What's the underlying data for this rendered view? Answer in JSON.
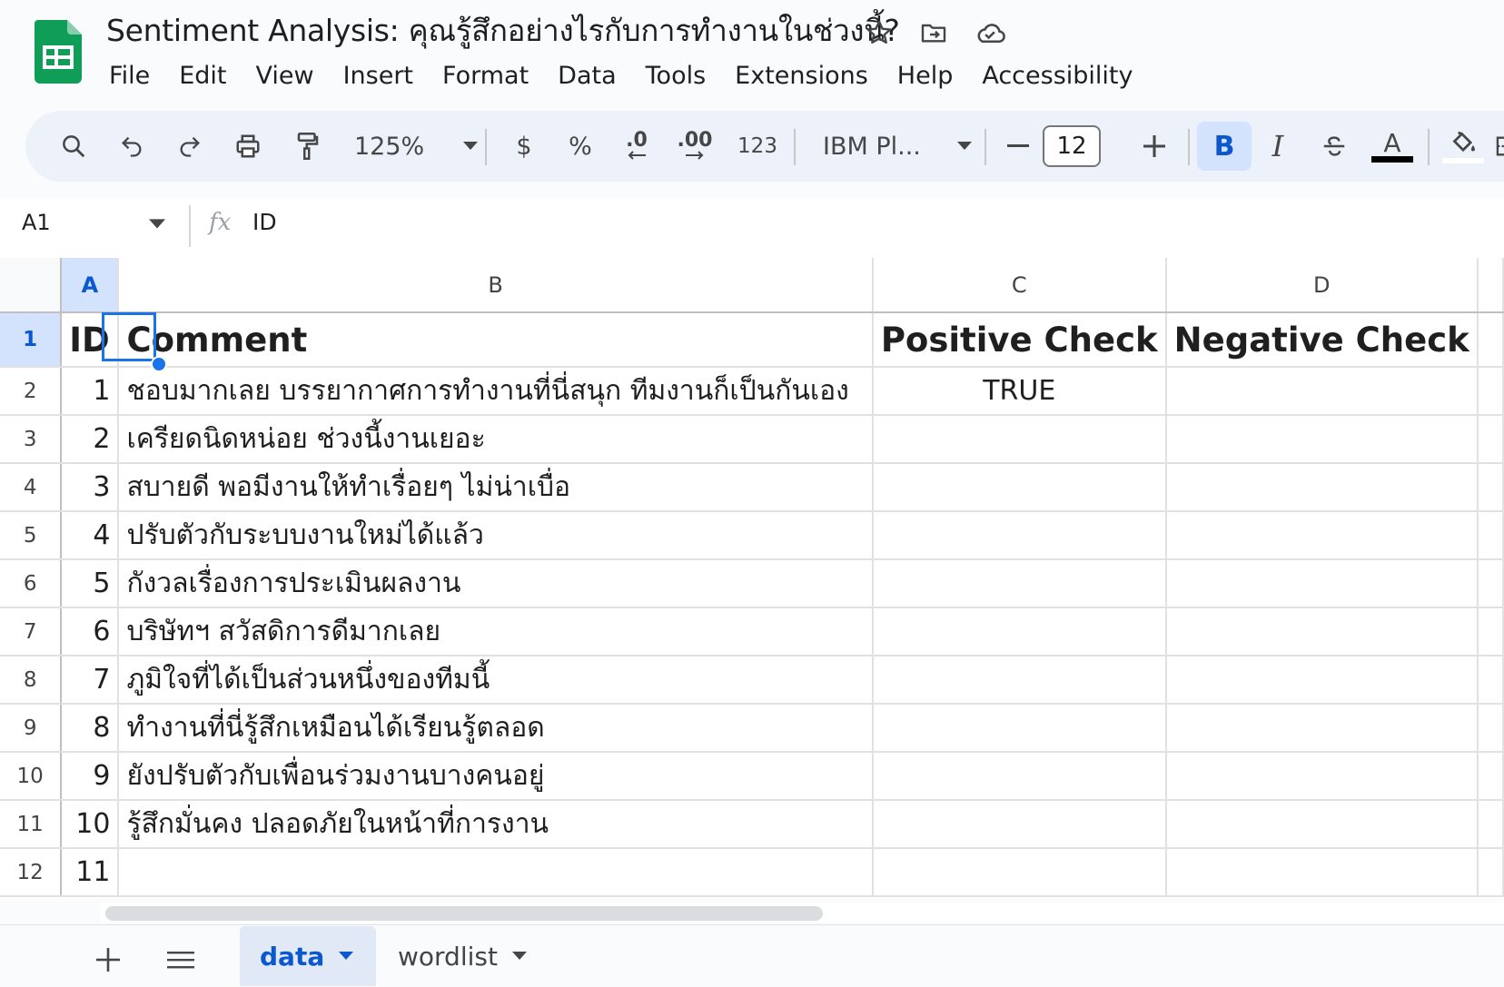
{
  "title": "Sentiment Analysis: คุณรู้สึกอย่างไรกับการทำงานในช่วงนี้?",
  "menu": [
    "File",
    "Edit",
    "View",
    "Insert",
    "Format",
    "Data",
    "Tools",
    "Extensions",
    "Help",
    "Accessibility"
  ],
  "toolbar": {
    "zoom": "125%",
    "currency": "$",
    "percent": "%",
    "decrease_decimal": ".0",
    "increase_decimal": ".00",
    "number_format": "123",
    "font": "IBM Pl...",
    "font_size": "12",
    "bold": "B",
    "italic": "I",
    "text_color": "A"
  },
  "formula_bar": {
    "name_box": "A1",
    "fx": "fx",
    "value": "ID"
  },
  "columns": [
    "A",
    "B",
    "C",
    "D"
  ],
  "rows": [
    {
      "num": "1",
      "a": "ID",
      "b": "Comment",
      "c": "Positive Check",
      "d": "Negative Check"
    },
    {
      "num": "2",
      "a": "1",
      "b": "ชอบมากเลย บรรยากาศการทำงานที่นี่สนุก ทีมงานก็เป็นกันเอง",
      "c": "TRUE",
      "d": ""
    },
    {
      "num": "3",
      "a": "2",
      "b": "เครียดนิดหน่อย ช่วงนี้งานเยอะ",
      "c": "",
      "d": ""
    },
    {
      "num": "4",
      "a": "3",
      "b": "สบายดี พอมีงานให้ทำเรื่อยๆ ไม่น่าเบื่อ",
      "c": "",
      "d": ""
    },
    {
      "num": "5",
      "a": "4",
      "b": "ปรับตัวกับระบบงานใหม่ได้แล้ว",
      "c": "",
      "d": ""
    },
    {
      "num": "6",
      "a": "5",
      "b": "กังวลเรื่องการประเมินผลงาน",
      "c": "",
      "d": ""
    },
    {
      "num": "7",
      "a": "6",
      "b": "บริษัทฯ สวัสดิการดีมากเลย",
      "c": "",
      "d": ""
    },
    {
      "num": "8",
      "a": "7",
      "b": "ภูมิใจที่ได้เป็นส่วนหนึ่งของทีมนี้",
      "c": "",
      "d": ""
    },
    {
      "num": "9",
      "a": "8",
      "b": "ทำงานที่นี่รู้สึกเหมือนได้เรียนรู้ตลอด",
      "c": "",
      "d": ""
    },
    {
      "num": "10",
      "a": "9",
      "b": "ยังปรับตัวกับเพื่อนร่วมงานบางคนอยู่",
      "c": "",
      "d": ""
    },
    {
      "num": "11",
      "a": "10",
      "b": "รู้สึกมั่นคง ปลอดภัยในหน้าที่การงาน",
      "c": "",
      "d": ""
    },
    {
      "num": "12",
      "a": "11",
      "b": "",
      "c": "",
      "d": ""
    }
  ],
  "sheet_tabs": [
    "data",
    "wordlist"
  ],
  "colors": {
    "accent": "#0b57d0",
    "selection": "#1a73e8",
    "toolbar_bg": "#edf2fa",
    "logo": "#0f9d58"
  }
}
